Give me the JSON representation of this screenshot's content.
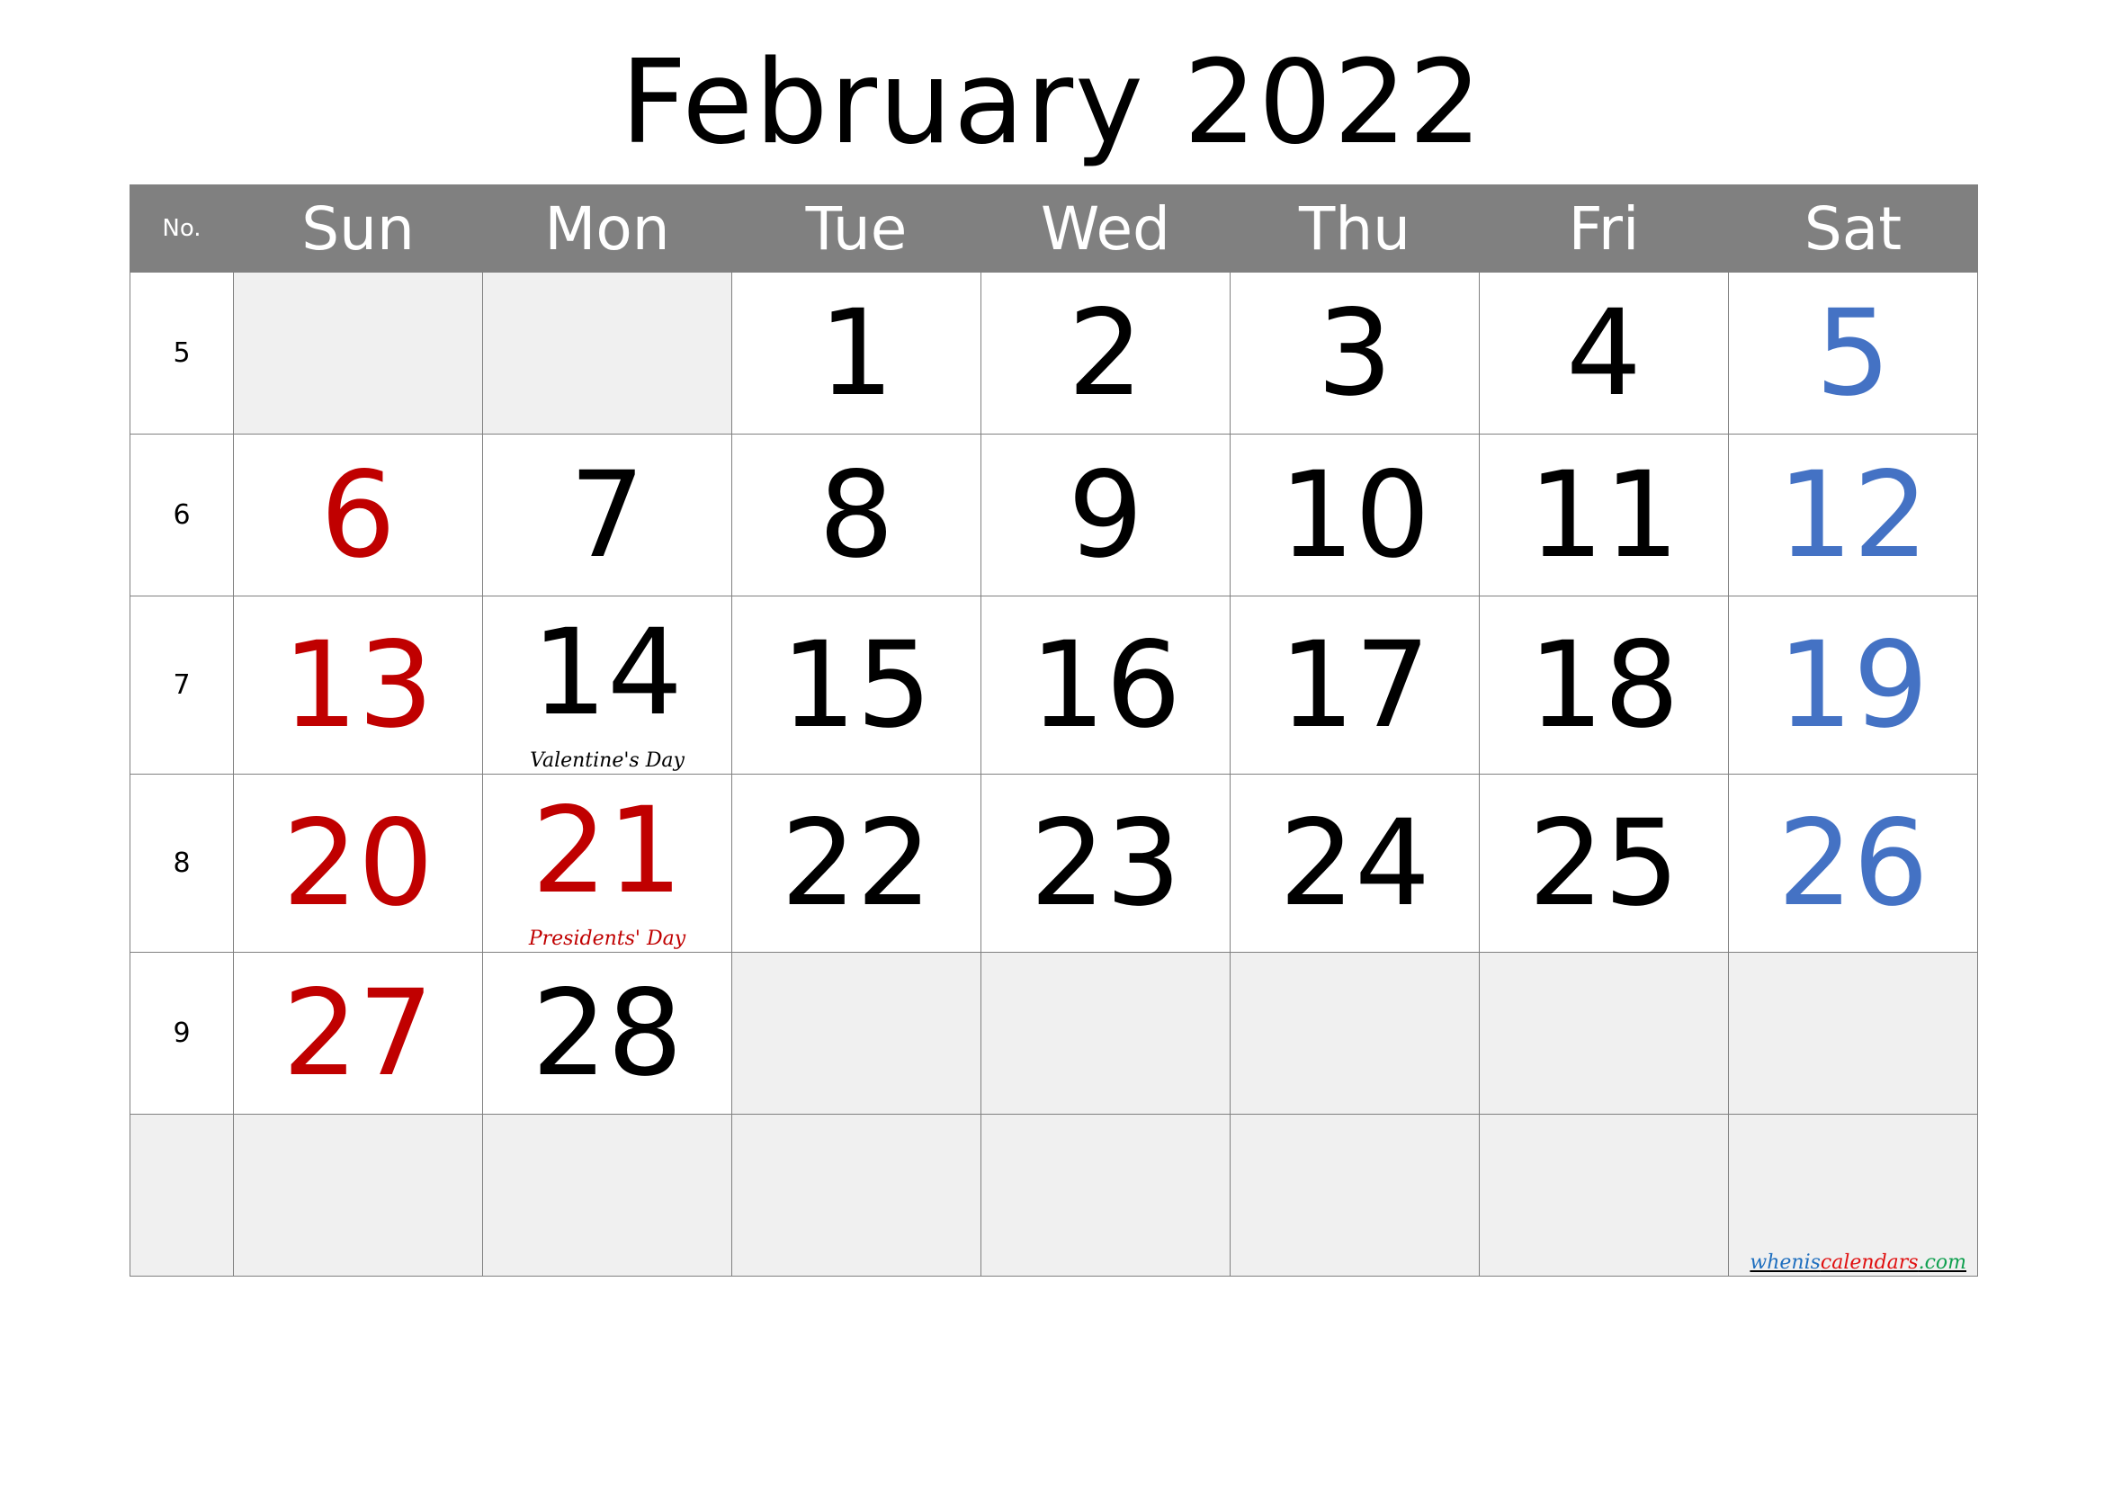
{
  "title": "February 2022",
  "header": {
    "week_no_label": "No.",
    "days": [
      "Sun",
      "Mon",
      "Tue",
      "Wed",
      "Thu",
      "Fri",
      "Sat"
    ]
  },
  "colors": {
    "header_bg": "#808080",
    "empty_cell": "#f0f0f0",
    "weekday": "#000000",
    "sunday_holiday": "#c00000",
    "saturday": "#4472c4"
  },
  "weeks": [
    {
      "no": "5",
      "days": [
        {
          "day": "",
          "empty": true
        },
        {
          "day": "",
          "empty": true
        },
        {
          "day": "1",
          "color": "black"
        },
        {
          "day": "2",
          "color": "black"
        },
        {
          "day": "3",
          "color": "black"
        },
        {
          "day": "4",
          "color": "black"
        },
        {
          "day": "5",
          "color": "blue"
        }
      ]
    },
    {
      "no": "6",
      "days": [
        {
          "day": "6",
          "color": "red"
        },
        {
          "day": "7",
          "color": "black"
        },
        {
          "day": "8",
          "color": "black"
        },
        {
          "day": "9",
          "color": "black"
        },
        {
          "day": "10",
          "color": "black"
        },
        {
          "day": "11",
          "color": "black"
        },
        {
          "day": "12",
          "color": "blue"
        }
      ]
    },
    {
      "no": "7",
      "days": [
        {
          "day": "13",
          "color": "red"
        },
        {
          "day": "14",
          "color": "black",
          "holiday": "Valentine's Day",
          "holiday_color": "black"
        },
        {
          "day": "15",
          "color": "black"
        },
        {
          "day": "16",
          "color": "black"
        },
        {
          "day": "17",
          "color": "black"
        },
        {
          "day": "18",
          "color": "black"
        },
        {
          "day": "19",
          "color": "blue"
        }
      ]
    },
    {
      "no": "8",
      "days": [
        {
          "day": "20",
          "color": "red"
        },
        {
          "day": "21",
          "color": "red",
          "holiday": "Presidents' Day",
          "holiday_color": "red"
        },
        {
          "day": "22",
          "color": "black"
        },
        {
          "day": "23",
          "color": "black"
        },
        {
          "day": "24",
          "color": "black"
        },
        {
          "day": "25",
          "color": "black"
        },
        {
          "day": "26",
          "color": "blue"
        }
      ]
    },
    {
      "no": "9",
      "days": [
        {
          "day": "27",
          "color": "red"
        },
        {
          "day": "28",
          "color": "black"
        },
        {
          "day": "",
          "empty": true
        },
        {
          "day": "",
          "empty": true
        },
        {
          "day": "",
          "empty": true
        },
        {
          "day": "",
          "empty": true
        },
        {
          "day": "",
          "empty": true
        }
      ]
    },
    {
      "no": "",
      "empty_row": true,
      "days": [
        {
          "day": "",
          "empty": true
        },
        {
          "day": "",
          "empty": true
        },
        {
          "day": "",
          "empty": true
        },
        {
          "day": "",
          "empty": true
        },
        {
          "day": "",
          "empty": true
        },
        {
          "day": "",
          "empty": true
        },
        {
          "day": "",
          "empty": true
        }
      ]
    }
  ],
  "watermark": {
    "part1": "whenis",
    "part2": "calendars",
    "part3": ".com"
  }
}
